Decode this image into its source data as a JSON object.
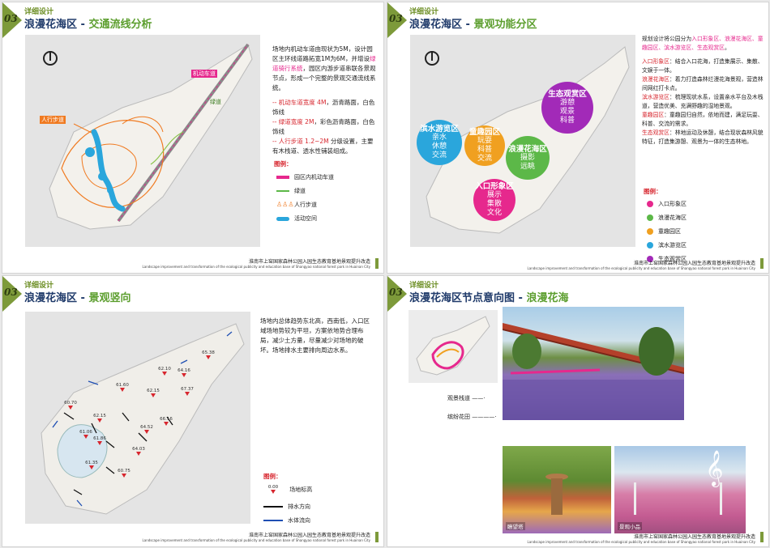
{
  "common": {
    "section_number": "03",
    "section_name": "详细设计",
    "footer_cn": "淮南市上窑国家森林公园入园生态教育基地景观提升改造",
    "footer_en": "Landscape improvement and transformation of the ecological publicity and education base of Shangyao national forest park in Huainan City",
    "legend_label": "图例："
  },
  "p1": {
    "title": "浪漫花海区",
    "subtitle": "交通流线分析",
    "desc_1": "场地内机动车道由现状为5M，设计园区主环线道路拓宽1M为6M，并增设",
    "desc_1_hl": "绿道骑行系统",
    "desc_1_end": "，园区内游步道串联各景观节点，形成一个完整的景观交通流线系统。",
    "b1": "-- 机动车道宽度 4M",
    "b1_end": "，沥青路面，白色饰线",
    "b2": "-- 绿道宽度 2M",
    "b2_end": "，彩色沥青路面，白色饰线",
    "b3": "-- 人行步道 1.2~2M",
    "b3_end": " 分级设置，主要有木栈道、透水性铺装组成。",
    "map_label_road": "机动车道",
    "map_label_walk": "人行步道",
    "map_label_green": "绿道",
    "legend": [
      "园区内机动车道",
      "绿道",
      "人行步道",
      "活动空间"
    ]
  },
  "p2": {
    "title": "浪漫花海区",
    "subtitle": "景观功能分区",
    "intro": "规划设计将公园分为",
    "intro_hl": "入口形象区、浪漫花海区、童趣园区、滨水游览区、生态观赏区",
    "intro_end": "。",
    "items": [
      {
        "name": "入口形象区",
        "text": "：结合入口花海，打造集展示、集散、文娱于一体。"
      },
      {
        "name": "浪漫花海区",
        "text": "：着力打造森林烂漫花海景观，营造林间网红打卡点。"
      },
      {
        "name": "滨水游览区",
        "text": "：梳理现状水系，设置亲水平台及木栈道，营造优美、充满野趣的湿地景观。"
      },
      {
        "name": "童趣园区",
        "text": "：童趣园归自然，依地而建，满足玩耍、科普、交流的需求。"
      },
      {
        "name": "生态观赏区",
        "text": "：林地运动及休憩，结合现状森林风貌特征，打造集游憩、观景为一体的生态林地。"
      }
    ],
    "bubbles": [
      {
        "title": "生态观赏区",
        "lines": [
          "游憩",
          "观景",
          "科普"
        ],
        "color": "#a22ab8"
      },
      {
        "title": "滨水游览区",
        "lines": [
          "亲水",
          "休憩",
          "交流"
        ],
        "color": "#2aa6dc"
      },
      {
        "title": "童趣园区",
        "lines": [
          "玩耍",
          "科普",
          "交流"
        ],
        "color": "#f0a020"
      },
      {
        "title": "浪漫花海区",
        "lines": [
          "摄影",
          "远眺"
        ],
        "color": "#5cb848"
      },
      {
        "title": "入口形象区",
        "lines": [
          "展示",
          "集散",
          "文化"
        ],
        "color": "#e6288d"
      }
    ],
    "legend": [
      {
        "label": "入口形象区",
        "color": "#e6288d"
      },
      {
        "label": "浪漫花海区",
        "color": "#5cb848"
      },
      {
        "label": "童趣园区",
        "color": "#f0a020"
      },
      {
        "label": "滨水游览区",
        "color": "#2aa6dc"
      },
      {
        "label": "生态观赏区",
        "color": "#a22ab8"
      }
    ]
  },
  "p3": {
    "title": "浪漫花海区",
    "subtitle": "景观竖向",
    "desc": "场地内总体趋势东北高，西南低，入口区域场地势较为平坦，方案依地势合理布局，减少土方量，尽量减少对场地的破坏。场地排水主要排向周边水系。",
    "elevations": [
      "65.38",
      "62.10",
      "64.16",
      "67.37",
      "61.60",
      "62.15",
      "60.70",
      "62.15",
      "64.52",
      "66.16",
      "61.06",
      "61.86",
      "64.03",
      "61.35",
      "60.75"
    ],
    "legend": [
      "场地标高",
      "排水方向",
      "水体流向"
    ],
    "legend_sample": "0.00"
  },
  "p4": {
    "title": "浪漫花海区节点意向图",
    "subtitle": "浪漫花海",
    "ann_1": "观景栈道",
    "ann_2": "缤纷花田",
    "cap_1": "瞭望塔",
    "cap_2": "景观小品"
  }
}
